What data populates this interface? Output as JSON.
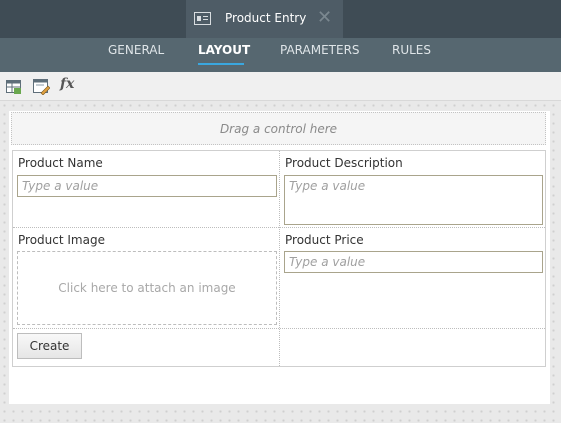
{
  "document_tab": {
    "title": "Product Entry",
    "icon": "form-icon",
    "close_glyph": "✕"
  },
  "nav": {
    "tabs": [
      {
        "label": "GENERAL",
        "active": false
      },
      {
        "label": "LAYOUT",
        "active": true
      },
      {
        "label": "PARAMETERS",
        "active": false
      },
      {
        "label": "RULES",
        "active": false
      }
    ],
    "accent_color": "#3aa7df"
  },
  "toolbar": {
    "buttons": [
      {
        "icon": "table-icon"
      },
      {
        "icon": "edit-layout-icon"
      },
      {
        "icon": "fx-icon",
        "glyph": "fx"
      }
    ]
  },
  "form": {
    "drag_hint": "Drag a control here",
    "fields": {
      "product_name": {
        "label": "Product Name",
        "placeholder": "Type a value"
      },
      "product_description": {
        "label": "Product Description",
        "placeholder": "Type a value"
      },
      "product_image": {
        "label": "Product Image",
        "attach_text": "Click here to attach an image"
      },
      "product_price": {
        "label": "Product Price",
        "placeholder": "Type a value"
      }
    },
    "create_label": "Create"
  },
  "colors": {
    "titlebar": "#3f4c55",
    "navbar": "#566770",
    "input_border": "#a9a48c"
  }
}
